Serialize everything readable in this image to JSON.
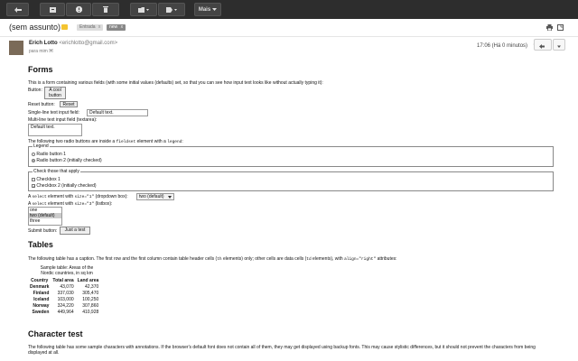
{
  "toolbar": {
    "buttons": [
      {
        "name": "back",
        "icon": "back-arrow-icon"
      },
      {
        "name": "archive",
        "icon": "archive-icon"
      },
      {
        "name": "spam",
        "icon": "report-spam-icon"
      },
      {
        "name": "delete",
        "icon": "trash-icon"
      },
      {
        "name": "move",
        "icon": "folder-icon"
      },
      {
        "name": "labels",
        "icon": "label-icon"
      }
    ],
    "more_label": "Mais"
  },
  "message": {
    "subject": "(sem assunto)",
    "chips": [
      {
        "label": "Entrada",
        "close": "x"
      },
      {
        "label": "new",
        "close": "x"
      }
    ],
    "sender_name": "Erich Lotto",
    "sender_email": "<erichlotto@gmail.com>",
    "to": "para mim",
    "time": "17:06 (Há 0 minutos)",
    "star": "☆"
  },
  "forms": {
    "heading": "Forms",
    "intro": "This is a form containing various fields (with some initial values (defaults) set, so that you can see how input text looks like without actually typing it):",
    "button_label": "Button:",
    "cool_button": "A cool button",
    "reset_label": "Reset button:",
    "reset_button": "Reset",
    "single_line_label": "Single-line text input field:",
    "single_line_value": "Default text.",
    "multi_line_label": "Multi-line text input field (textarea):",
    "textarea_value": "Default text.",
    "radio_intro_before": "The following two radio buttons are inside a",
    "radio_intro_code1": "fieldset",
    "radio_intro_middle": "element with a",
    "radio_intro_code2": "legend",
    "radio_intro_after": ":",
    "legend_label": "Legend",
    "radio1": "Radio button 1",
    "radio2": "Radio button 2 (initially checked)",
    "check_legend": "Check those that apply",
    "checkbox1": "Checkbox 1",
    "checkbox2": "Checkbox 2 (initially checked)",
    "select1_prefix": "A",
    "select1_code1": "select",
    "select1_mid": "element with",
    "select1_code2": "size=\"1\"",
    "select1_suffix": "(dropdown box):",
    "select1_value": "two (default)",
    "select2_prefix": "A",
    "select2_code1": "select",
    "select2_mid": "element with",
    "select2_code2": "size=\"3\"",
    "select2_suffix": "(listbox):",
    "listbox_options": [
      "one",
      "two (default)",
      "three"
    ],
    "submit_label": "Submit button:",
    "submit_button": "Just a test"
  },
  "tables": {
    "heading": "Tables",
    "intro_before": "The following table has a caption. The first row and the first column contain table header cells (",
    "intro_code1": "th",
    "intro_middle": "elements) only; other cells are data cells (",
    "intro_code2": "td",
    "intro_middle2": "elements), with",
    "intro_code3": "align=\"right\"",
    "intro_after": "attributes:",
    "caption": "Sample table: Areas of the Nordic countries, in sq km",
    "columns": [
      "Country",
      "Total area",
      "Land area"
    ],
    "rows": [
      [
        "Denmark",
        "43,070",
        "42,370"
      ],
      [
        "Finland",
        "337,030",
        "305,470"
      ],
      [
        "Iceland",
        "103,000",
        "100,250"
      ],
      [
        "Norway",
        "324,220",
        "307,860"
      ],
      [
        "Sweden",
        "449,964",
        "410,928"
      ]
    ]
  },
  "charset": {
    "heading": "Character test",
    "intro": "The following table has some sample characters with annotations. If the browser's default font does not contain all of them, they may get displayed using backup fonts. This may cause stylistic differences, but it should not prevent the characters from being displayed at all."
  }
}
